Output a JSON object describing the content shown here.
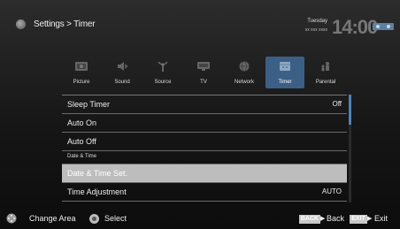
{
  "header": {
    "breadcrumb": "Settings > Timer",
    "day": "Tuesday",
    "date": "xx xxx xxxx",
    "time": "14:00"
  },
  "tabs": [
    {
      "label": "Picture",
      "icon": "picture-icon",
      "active": false
    },
    {
      "label": "Sound",
      "icon": "speaker-icon",
      "active": false
    },
    {
      "label": "Source",
      "icon": "antenna-icon",
      "active": false
    },
    {
      "label": "TV",
      "icon": "tv-icon",
      "active": false
    },
    {
      "label": "Network",
      "icon": "globe-icon",
      "active": false
    },
    {
      "label": "Timer",
      "icon": "timer-icon",
      "active": true
    },
    {
      "label": "Parental",
      "icon": "parental-icon",
      "active": false
    }
  ],
  "menu": {
    "rows": [
      {
        "label": "Sleep Timer",
        "value": "Off"
      },
      {
        "label": "Auto On",
        "value": ""
      },
      {
        "label": "Auto Off",
        "value": ""
      },
      {
        "label": "Date & Time",
        "value": ""
      },
      {
        "label": "Date & Time Set.",
        "value": ""
      },
      {
        "label": "Time Adjustment",
        "value": "AUTO"
      }
    ]
  },
  "footer": {
    "change_area": "Change Area",
    "select": "Select",
    "back_key": "BACK",
    "back": "Back",
    "exit_key": "EXIT",
    "exit": "Exit",
    "arrow": "▶"
  },
  "colors": {
    "accent": "#3c5f86",
    "selected_row": "#bdbdbd",
    "scroll_thumb": "#4f83b5"
  }
}
